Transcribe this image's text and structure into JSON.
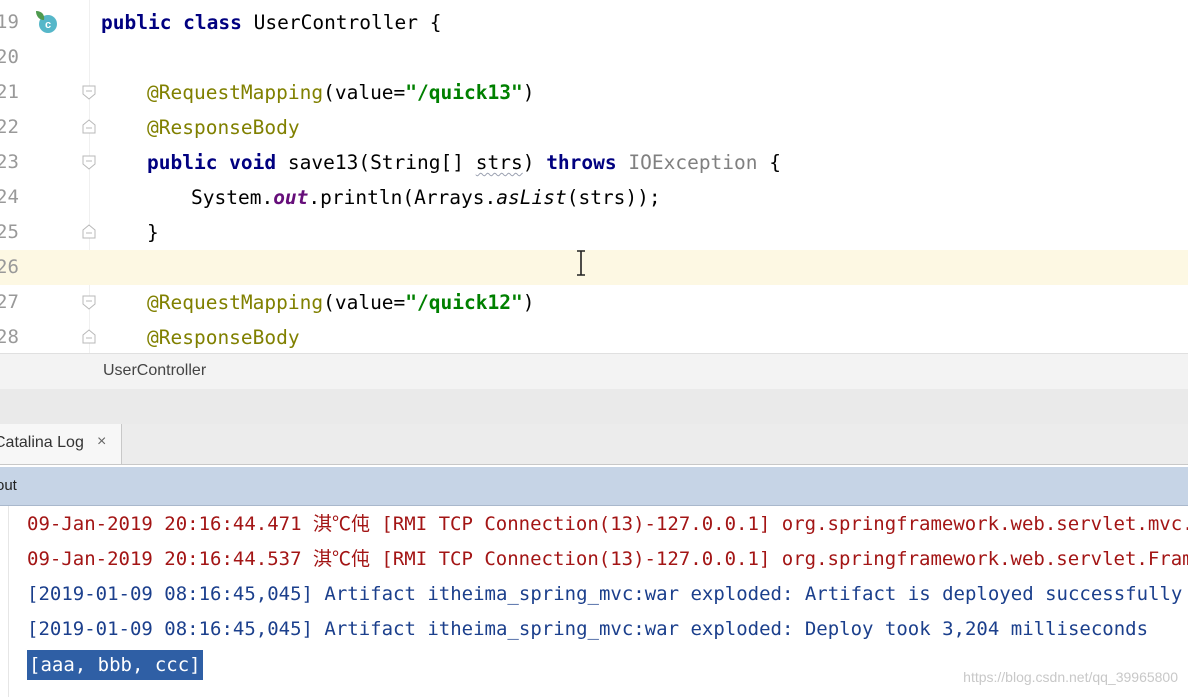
{
  "editor": {
    "lines": [
      {
        "num": "19",
        "tokens": [
          {
            "t": "public class ",
            "c": "kw"
          },
          {
            "t": "UserController {",
            "c": ""
          }
        ]
      },
      {
        "num": "20",
        "tokens": []
      },
      {
        "num": "21",
        "tokens": [
          {
            "t": "@RequestMapping",
            "c": "ann"
          },
          {
            "t": "(value=",
            "c": ""
          },
          {
            "t": "\"/quick13\"",
            "c": "str"
          },
          {
            "t": ")",
            "c": ""
          }
        ]
      },
      {
        "num": "22",
        "tokens": [
          {
            "t": "@ResponseBody",
            "c": "ann"
          }
        ]
      },
      {
        "num": "23",
        "tokens": [
          {
            "t": "public void ",
            "c": "kw"
          },
          {
            "t": "save13(String[] ",
            "c": ""
          },
          {
            "t": "strs",
            "c": "squig"
          },
          {
            "t": ") ",
            "c": ""
          },
          {
            "t": "throws ",
            "c": "kw"
          },
          {
            "t": "IOException",
            "c": "gray"
          },
          {
            "t": " {",
            "c": ""
          }
        ]
      },
      {
        "num": "24",
        "tokens": [
          {
            "t": "System.",
            "c": ""
          },
          {
            "t": "out",
            "c": "fld"
          },
          {
            "t": ".println(Arrays.",
            "c": ""
          },
          {
            "t": "asList",
            "c": "ital"
          },
          {
            "t": "(strs));",
            "c": ""
          }
        ]
      },
      {
        "num": "25",
        "tokens": [
          {
            "t": "}",
            "c": ""
          }
        ]
      },
      {
        "num": "26",
        "tokens": []
      },
      {
        "num": "27",
        "tokens": [
          {
            "t": "@RequestMapping",
            "c": "ann"
          },
          {
            "t": "(value=",
            "c": ""
          },
          {
            "t": "\"/quick12\"",
            "c": "str"
          },
          {
            "t": ")",
            "c": ""
          }
        ]
      },
      {
        "num": "28",
        "tokens": [
          {
            "t": "@ResponseBody",
            "c": "ann"
          }
        ]
      }
    ],
    "current_line": "26"
  },
  "breadcrumb": {
    "label": "UserController"
  },
  "tabs": {
    "active_label": "Catalina Log",
    "close_glyph": "×"
  },
  "output_header": {
    "label": "out"
  },
  "console": {
    "lines": [
      {
        "text": "09-Jan-2019 20:16:44.471 淇℃伅 [RMI TCP Connection(13)-127.0.0.1] org.springframework.web.servlet.mvc.m",
        "style": "red"
      },
      {
        "text": "09-Jan-2019 20:16:44.537 淇℃伅 [RMI TCP Connection(13)-127.0.0.1] org.springframework.web.servlet.Fram",
        "style": "red"
      },
      {
        "text": "[2019-01-09 08:16:45,045] Artifact itheima_spring_mvc:war exploded: Artifact is deployed successfully",
        "style": "blue"
      },
      {
        "text": "[2019-01-09 08:16:45,045] Artifact itheima_spring_mvc:war exploded: Deploy took 3,204 milliseconds",
        "style": "blue"
      },
      {
        "text": "[aaa, bbb, ccc]",
        "style": "sel"
      }
    ]
  },
  "watermark": "https://blog.csdn.net/qq_39965800",
  "colors": {
    "keyword": "#000080",
    "annotation": "#808000",
    "string": "#008000",
    "log_red": "#a31515",
    "log_blue": "#1b3f8c",
    "selection": "#2f5fa5",
    "current_line": "#fdf8e3"
  }
}
